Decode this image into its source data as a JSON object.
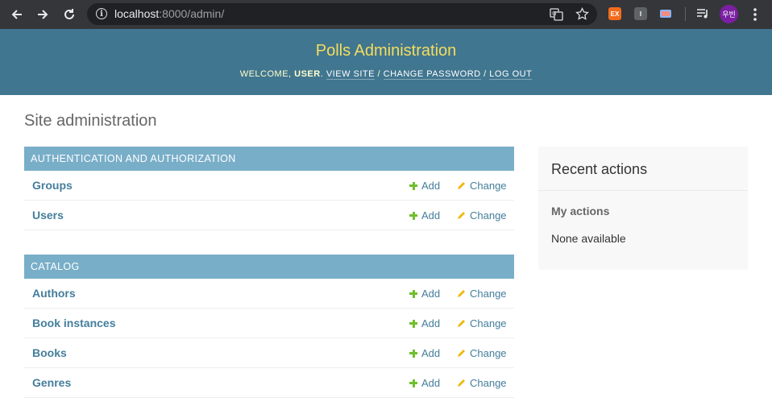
{
  "browser": {
    "url_host": "localhost",
    "url_rest": ":8000/admin/",
    "profile_initials": "우빈",
    "ext1_label": "EX",
    "ext2_label": "I"
  },
  "header": {
    "site_title": "Polls Administration",
    "welcome": "Welcome,",
    "username": "user",
    "view_site": "View site",
    "change_password": "Change password",
    "log_out": "Log out",
    "sep": " / "
  },
  "page": {
    "title": "Site administration"
  },
  "modules": [
    {
      "caption": "Authentication and Authorization",
      "models": [
        {
          "name": "Groups",
          "add": "Add",
          "change": "Change"
        },
        {
          "name": "Users",
          "add": "Add",
          "change": "Change"
        }
      ]
    },
    {
      "caption": "Catalog",
      "models": [
        {
          "name": "Authors",
          "add": "Add",
          "change": "Change"
        },
        {
          "name": "Book instances",
          "add": "Add",
          "change": "Change"
        },
        {
          "name": "Books",
          "add": "Add",
          "change": "Change"
        },
        {
          "name": "Genres",
          "add": "Add",
          "change": "Change"
        }
      ]
    }
  ],
  "recent": {
    "title": "Recent actions",
    "subtitle": "My actions",
    "empty": "None available"
  }
}
